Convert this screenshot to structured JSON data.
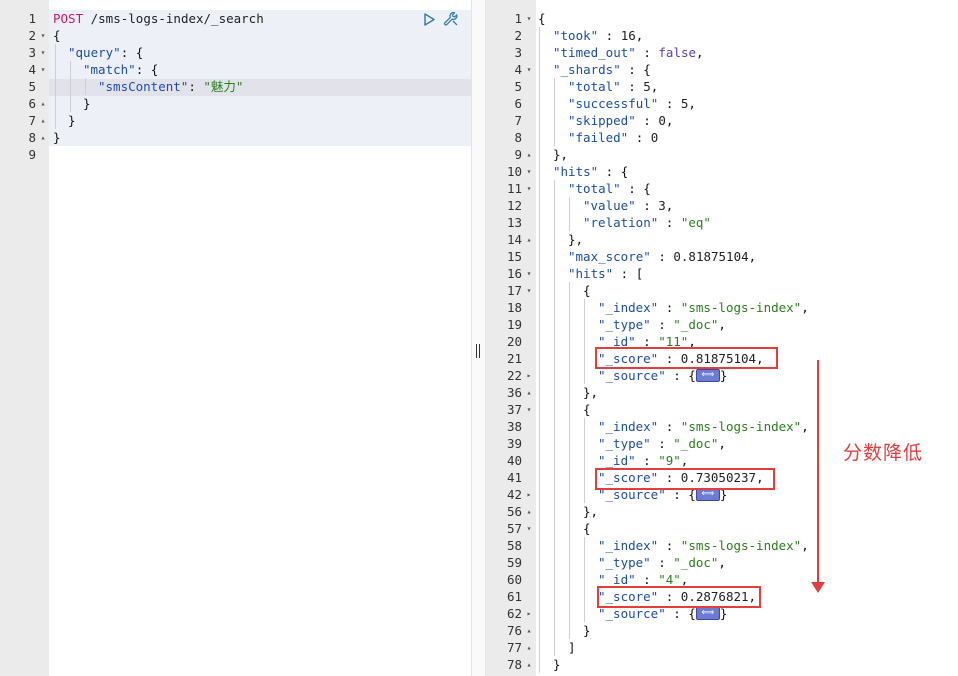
{
  "request": {
    "method": "POST",
    "url": " /sms-logs-index/_search",
    "lines": [
      {
        "n": "1",
        "fold": "",
        "indent": 0,
        "parts": [
          [
            "k-method",
            "POST"
          ],
          [
            "k-url",
            " /sms-logs-index/_search"
          ]
        ]
      },
      {
        "n": "2",
        "fold": "▾",
        "indent": 0,
        "parts": [
          [
            "",
            "{"
          ]
        ]
      },
      {
        "n": "3",
        "fold": "▾",
        "indent": 1,
        "parts": [
          [
            "k-key",
            "\"query\""
          ],
          [
            "",
            ": {"
          ]
        ]
      },
      {
        "n": "4",
        "fold": "▾",
        "indent": 2,
        "parts": [
          [
            "k-key",
            "\"match\""
          ],
          [
            "",
            ": {"
          ]
        ]
      },
      {
        "n": "5",
        "fold": "",
        "indent": 3,
        "parts": [
          [
            "k-key",
            "\"smsContent\""
          ],
          [
            "",
            ": "
          ],
          [
            "k-str",
            "\"魅力\""
          ]
        ]
      },
      {
        "n": "6",
        "fold": "▴",
        "indent": 2,
        "parts": [
          [
            "",
            "}"
          ]
        ]
      },
      {
        "n": "7",
        "fold": "▴",
        "indent": 1,
        "parts": [
          [
            "",
            "}"
          ]
        ]
      },
      {
        "n": "8",
        "fold": "▴",
        "indent": 0,
        "parts": [
          [
            "",
            "}"
          ]
        ]
      },
      {
        "n": "9",
        "fold": "",
        "indent": 0,
        "parts": [
          [
            "",
            ""
          ]
        ]
      }
    ],
    "run_icon": "play-icon",
    "settings_icon": "wrench-icon"
  },
  "response": {
    "lines": [
      {
        "n": "1",
        "fold": "▾",
        "indent": 0,
        "parts": [
          [
            "",
            "{"
          ]
        ]
      },
      {
        "n": "2",
        "fold": "",
        "indent": 1,
        "parts": [
          [
            "k-key",
            "\"took\""
          ],
          [
            "",
            " : "
          ],
          [
            "k-num",
            "16"
          ],
          [
            "",
            ","
          ]
        ]
      },
      {
        "n": "3",
        "fold": "",
        "indent": 1,
        "parts": [
          [
            "k-key",
            "\"timed_out\""
          ],
          [
            "",
            " : "
          ],
          [
            "k-bool",
            "false"
          ],
          [
            "",
            ","
          ]
        ]
      },
      {
        "n": "4",
        "fold": "▾",
        "indent": 1,
        "parts": [
          [
            "k-key",
            "\"_shards\""
          ],
          [
            "",
            " : {"
          ]
        ]
      },
      {
        "n": "5",
        "fold": "",
        "indent": 2,
        "parts": [
          [
            "k-key",
            "\"total\""
          ],
          [
            "",
            " : "
          ],
          [
            "k-num",
            "5"
          ],
          [
            "",
            ","
          ]
        ]
      },
      {
        "n": "6",
        "fold": "",
        "indent": 2,
        "parts": [
          [
            "k-key",
            "\"successful\""
          ],
          [
            "",
            " : "
          ],
          [
            "k-num",
            "5"
          ],
          [
            "",
            ","
          ]
        ]
      },
      {
        "n": "7",
        "fold": "",
        "indent": 2,
        "parts": [
          [
            "k-key",
            "\"skipped\""
          ],
          [
            "",
            " : "
          ],
          [
            "k-num",
            "0"
          ],
          [
            "",
            ","
          ]
        ]
      },
      {
        "n": "8",
        "fold": "",
        "indent": 2,
        "parts": [
          [
            "k-key",
            "\"failed\""
          ],
          [
            "",
            " : "
          ],
          [
            "k-num",
            "0"
          ]
        ]
      },
      {
        "n": "9",
        "fold": "▴",
        "indent": 1,
        "parts": [
          [
            "",
            "},"
          ]
        ]
      },
      {
        "n": "10",
        "fold": "▾",
        "indent": 1,
        "parts": [
          [
            "k-key",
            "\"hits\""
          ],
          [
            "",
            " : {"
          ]
        ]
      },
      {
        "n": "11",
        "fold": "▾",
        "indent": 2,
        "parts": [
          [
            "k-key",
            "\"total\""
          ],
          [
            "",
            " : {"
          ]
        ]
      },
      {
        "n": "12",
        "fold": "",
        "indent": 3,
        "parts": [
          [
            "k-key",
            "\"value\""
          ],
          [
            "",
            " : "
          ],
          [
            "k-num",
            "3"
          ],
          [
            "",
            ","
          ]
        ]
      },
      {
        "n": "13",
        "fold": "",
        "indent": 3,
        "parts": [
          [
            "k-key",
            "\"relation\""
          ],
          [
            "",
            " : "
          ],
          [
            "k-str",
            "\"eq\""
          ]
        ]
      },
      {
        "n": "14",
        "fold": "▴",
        "indent": 2,
        "parts": [
          [
            "",
            "},"
          ]
        ]
      },
      {
        "n": "15",
        "fold": "",
        "indent": 2,
        "parts": [
          [
            "k-key",
            "\"max_score\""
          ],
          [
            "",
            " : "
          ],
          [
            "k-num",
            "0.81875104"
          ],
          [
            "",
            ","
          ]
        ]
      },
      {
        "n": "16",
        "fold": "▾",
        "indent": 2,
        "parts": [
          [
            "k-key",
            "\"hits\""
          ],
          [
            "",
            " : ["
          ]
        ]
      },
      {
        "n": "17",
        "fold": "▾",
        "indent": 3,
        "parts": [
          [
            "",
            "{"
          ]
        ]
      },
      {
        "n": "18",
        "fold": "",
        "indent": 4,
        "parts": [
          [
            "k-key",
            "\"_index\""
          ],
          [
            "",
            " : "
          ],
          [
            "k-str",
            "\"sms-logs-index\""
          ],
          [
            "",
            ","
          ]
        ]
      },
      {
        "n": "19",
        "fold": "",
        "indent": 4,
        "parts": [
          [
            "k-key",
            "\"_type\""
          ],
          [
            "",
            " : "
          ],
          [
            "k-str",
            "\"_doc\""
          ],
          [
            "",
            ","
          ]
        ]
      },
      {
        "n": "20",
        "fold": "",
        "indent": 4,
        "parts": [
          [
            "k-key",
            "\"_id\""
          ],
          [
            "",
            " : "
          ],
          [
            "k-str",
            "\"11\""
          ],
          [
            "",
            ","
          ]
        ]
      },
      {
        "n": "21",
        "fold": "",
        "indent": 4,
        "parts": [
          [
            "k-key",
            "\"_score\""
          ],
          [
            "",
            " : "
          ],
          [
            "k-num",
            "0.81875104"
          ],
          [
            "",
            ","
          ]
        ]
      },
      {
        "n": "22",
        "fold": "▸",
        "indent": 4,
        "parts": [
          [
            "k-key",
            "\"_source\""
          ],
          [
            "",
            " : {"
          ],
          [
            "badge",
            "⟺"
          ],
          [
            "",
            "}"
          ]
        ]
      },
      {
        "n": "36",
        "fold": "▴",
        "indent": 3,
        "parts": [
          [
            "",
            "},"
          ]
        ]
      },
      {
        "n": "37",
        "fold": "▾",
        "indent": 3,
        "parts": [
          [
            "",
            "{"
          ]
        ]
      },
      {
        "n": "38",
        "fold": "",
        "indent": 4,
        "parts": [
          [
            "k-key",
            "\"_index\""
          ],
          [
            "",
            " : "
          ],
          [
            "k-str",
            "\"sms-logs-index\""
          ],
          [
            "",
            ","
          ]
        ]
      },
      {
        "n": "39",
        "fold": "",
        "indent": 4,
        "parts": [
          [
            "k-key",
            "\"_type\""
          ],
          [
            "",
            " : "
          ],
          [
            "k-str",
            "\"_doc\""
          ],
          [
            "",
            ","
          ]
        ]
      },
      {
        "n": "40",
        "fold": "",
        "indent": 4,
        "parts": [
          [
            "k-key",
            "\"_id\""
          ],
          [
            "",
            " : "
          ],
          [
            "k-str",
            "\"9\""
          ],
          [
            "",
            ","
          ]
        ]
      },
      {
        "n": "41",
        "fold": "",
        "indent": 4,
        "parts": [
          [
            "k-key",
            "\"_score\""
          ],
          [
            "",
            " : "
          ],
          [
            "k-num",
            "0.73050237"
          ],
          [
            "",
            ","
          ]
        ]
      },
      {
        "n": "42",
        "fold": "▸",
        "indent": 4,
        "parts": [
          [
            "k-key",
            "\"_source\""
          ],
          [
            "",
            " : {"
          ],
          [
            "badge",
            "⟺"
          ],
          [
            "",
            "}"
          ]
        ]
      },
      {
        "n": "56",
        "fold": "▴",
        "indent": 3,
        "parts": [
          [
            "",
            "},"
          ]
        ]
      },
      {
        "n": "57",
        "fold": "▾",
        "indent": 3,
        "parts": [
          [
            "",
            "{"
          ]
        ]
      },
      {
        "n": "58",
        "fold": "",
        "indent": 4,
        "parts": [
          [
            "k-key",
            "\"_index\""
          ],
          [
            "",
            " : "
          ],
          [
            "k-str",
            "\"sms-logs-index\""
          ],
          [
            "",
            ","
          ]
        ]
      },
      {
        "n": "59",
        "fold": "",
        "indent": 4,
        "parts": [
          [
            "k-key",
            "\"_type\""
          ],
          [
            "",
            " : "
          ],
          [
            "k-str",
            "\"_doc\""
          ],
          [
            "",
            ","
          ]
        ]
      },
      {
        "n": "60",
        "fold": "",
        "indent": 4,
        "parts": [
          [
            "k-key",
            "\"_id\""
          ],
          [
            "",
            " : "
          ],
          [
            "k-str",
            "\"4\""
          ],
          [
            "",
            ","
          ]
        ]
      },
      {
        "n": "61",
        "fold": "",
        "indent": 4,
        "parts": [
          [
            "k-key",
            "\"_score\""
          ],
          [
            "",
            " : "
          ],
          [
            "k-num",
            "0.2876821"
          ],
          [
            "",
            ","
          ]
        ]
      },
      {
        "n": "62",
        "fold": "▸",
        "indent": 4,
        "parts": [
          [
            "k-key",
            "\"_source\""
          ],
          [
            "",
            " : {"
          ],
          [
            "badge",
            "⟺"
          ],
          [
            "",
            "}"
          ]
        ]
      },
      {
        "n": "76",
        "fold": "▴",
        "indent": 3,
        "parts": [
          [
            "",
            "}"
          ]
        ]
      },
      {
        "n": "77",
        "fold": "▴",
        "indent": 2,
        "parts": [
          [
            "",
            "]"
          ]
        ]
      },
      {
        "n": "78",
        "fold": "▴",
        "indent": 1,
        "parts": [
          [
            "",
            "}"
          ]
        ]
      }
    ]
  },
  "annotation": {
    "label": "分数降低",
    "color": "#e53c3c"
  },
  "colors": {
    "method": "#c41a6a",
    "key": "#1c4ea8",
    "string": "#2a7f1c",
    "boolean": "#5b3db3",
    "gutter": "#ebebeb",
    "request_highlight": "#eef0f7"
  }
}
